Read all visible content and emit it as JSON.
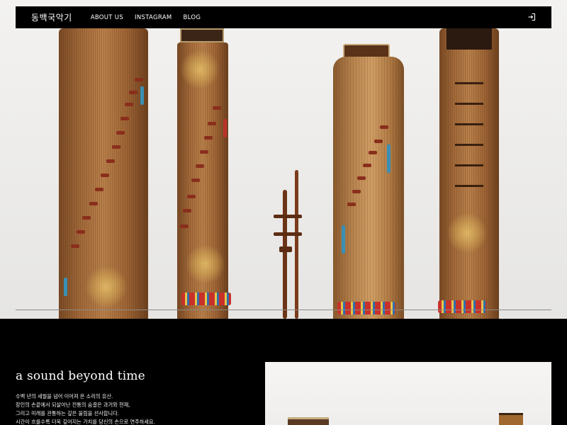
{
  "nav": {
    "logo": "동백국악기",
    "links": [
      "ABOUT US",
      "INSTAGRAM",
      "BLOG"
    ],
    "login_icon": "login-icon"
  },
  "hero": {
    "image_alt": "Korean traditional instruments: gayageum, ajaeng, haegeum, geomungo"
  },
  "intro": {
    "title": "a sound beyond time",
    "lines": [
      "수백 년의 세월을 넘어 이어져 온 소리의 유산.",
      "장인의 손끝에서 되살아난 전통의 숨결은 과거와 현재,",
      "그리고 미래를 관통하는 깊은 울림을 선사합니다.",
      "시간이 흐를수록 더욱 깊어지는 가치를 당신의 손으로 연주하세요."
    ]
  },
  "colors": {
    "background": "#000000",
    "text": "#ffffff"
  }
}
